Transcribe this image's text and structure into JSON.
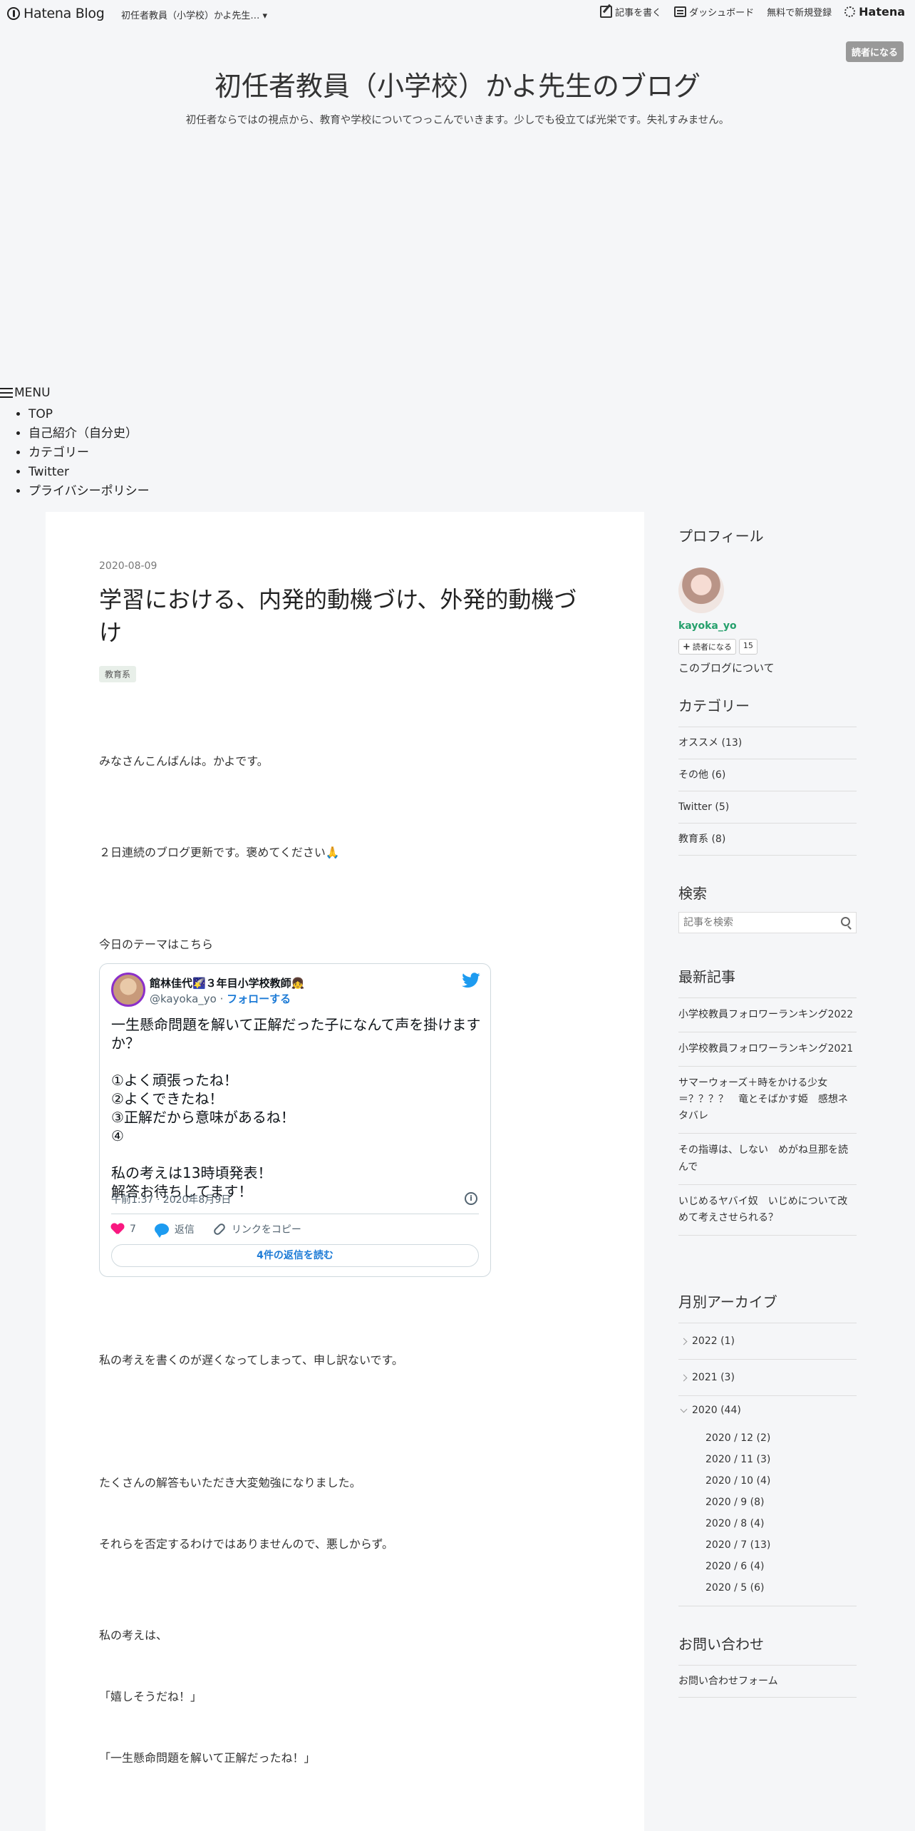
{
  "navbar": {
    "logo": "Hatena Blog",
    "blog_title": "初任者教員（小学校）かよ先生… ▾",
    "write": "記事を書く",
    "dashboard": "ダッシュボード",
    "register": "無料で新規登録",
    "hatena": "Hatena"
  },
  "subscribe_top": "読者になる",
  "blog": {
    "title": "初任者教員（小学校）かよ先生のブログ",
    "description": "初任者ならではの視点から、教育や学校についてつっこんでいきます。少しでも役立てば光栄です。失礼すみません。"
  },
  "menu": {
    "label": "MENU",
    "items": [
      "TOP",
      "自己紹介（自分史）",
      "カテゴリー",
      "Twitter",
      "プライバシーポリシー"
    ]
  },
  "entry": {
    "date": "2020-08-09",
    "title": "学習における、内発的動機づけ、外発的動機づけ",
    "category": "教育系",
    "paragraphs": [
      "みなさんこんばんは。かよです。",
      "２日連続のブログ更新です。褒めてください🙏",
      "今日のテーマはこちら",
      "私の考えを書くのが遅くなってしまって、申し訳ないです。",
      "たくさんの解答もいただき大変勉強になりました。",
      "それらを否定するわけではありませんので、悪しからず。",
      "私の考えは、",
      "「嬉しそうだね！」",
      "「一生懸命問題を解いて正解だったね！」"
    ]
  },
  "tweet": {
    "name": "館林佳代🌠３年目小学校教師👧",
    "handle": "@kayoka_yo",
    "follow": "フォローする",
    "text": "一生懸命問題を解いて正解だった子になんて声を掛けますか？\n\n①よく頑張ったね！\n②よくできたね！\n③正解だから意味があるね！\n④\n\n私の考えは13時頃発表！\n解答お待ちしてます！",
    "time": "午前1:37 · 2020年8月9日",
    "likes": "7",
    "reply": "返信",
    "copy_link": "リンクをコピー",
    "read_replies": "4件の返信を読む"
  },
  "sidebar": {
    "profile": {
      "heading": "プロフィール",
      "name": "kayoka_yo",
      "subscribe": "読者になる",
      "count": "15",
      "about": "このブログについて"
    },
    "categories": {
      "heading": "カテゴリー",
      "items": [
        "オススメ (13)",
        "その他 (6)",
        "Twitter (5)",
        "教育系 (8)"
      ]
    },
    "search": {
      "heading": "検索",
      "placeholder": "記事を検索"
    },
    "recent": {
      "heading": "最新記事",
      "items": [
        "小学校教員フォロワーランキング2022",
        "小学校教員フォロワーランキング2021",
        "サマーウォーズ＋時をかける少女＝？？？？　竜とそばかす姫　感想ネタバレ",
        "その指導は、しない　めがね旦那を読んで",
        "いじめるヤバイ奴　いじめについて改めて考えさせられる？"
      ]
    },
    "archive": {
      "heading": "月別アーカイブ",
      "years": [
        "2022 (1)",
        "2021 (3)",
        "2020 (44)"
      ],
      "months": [
        "2020 / 12 (2)",
        "2020 / 11 (3)",
        "2020 / 10 (4)",
        "2020 / 9 (8)",
        "2020 / 8 (4)",
        "2020 / 7 (13)",
        "2020 / 6 (4)",
        "2020 / 5 (6)"
      ]
    },
    "contact": {
      "heading": "お問い合わせ",
      "link": "お問い合わせフォーム"
    }
  }
}
